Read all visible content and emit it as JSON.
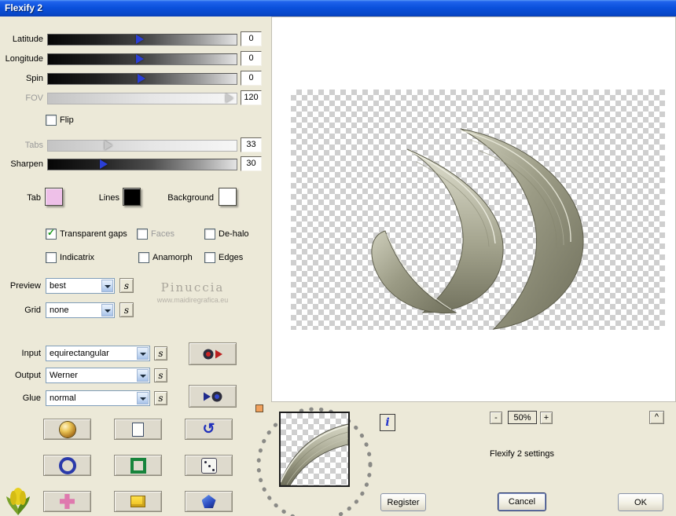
{
  "window": {
    "title": "Flexify 2"
  },
  "left": {
    "sliders": [
      {
        "label": "Latitude",
        "value": "0",
        "disabled": false
      },
      {
        "label": "Longitude",
        "value": "0",
        "disabled": false
      },
      {
        "label": "Spin",
        "value": "0",
        "disabled": false
      },
      {
        "label": "FOV",
        "value": "120",
        "disabled": true
      },
      {
        "label": "Tabs",
        "value": "33",
        "disabled": true
      },
      {
        "label": "Sharpen",
        "value": "30",
        "disabled": false
      }
    ],
    "flip_label": "Flip",
    "swatches": {
      "tab": {
        "label": "Tab",
        "color": "#eec0e8"
      },
      "lines": {
        "label": "Lines",
        "color": "#000000"
      },
      "background": {
        "label": "Background",
        "color": "#ffffff"
      }
    },
    "checkboxes": [
      {
        "label": "Transparent gaps",
        "checked": true,
        "disabled": false
      },
      {
        "label": "Faces",
        "checked": false,
        "disabled": true
      },
      {
        "label": "De-halo",
        "checked": false,
        "disabled": false
      },
      {
        "label": "Indicatrix",
        "checked": false,
        "disabled": false
      },
      {
        "label": "Anamorph",
        "checked": false,
        "disabled": false
      },
      {
        "label": "Edges",
        "checked": false,
        "disabled": false
      }
    ],
    "dropdowns": {
      "preview": {
        "label": "Preview",
        "value": "best"
      },
      "grid": {
        "label": "Grid",
        "value": "none"
      },
      "input": {
        "label": "Input",
        "value": "equirectangular"
      },
      "output": {
        "label": "Output",
        "value": "Werner"
      },
      "glue": {
        "label": "Glue",
        "value": "normal"
      }
    },
    "watermark": {
      "line1": "Pinuccia",
      "line2": "www.maidiregrafica.eu"
    },
    "tool_icons": [
      "shell",
      "copy-page",
      "undo",
      "ring",
      "green-square",
      "dice",
      "flower",
      "pink-cross",
      "yellow-box",
      "blue-pentagon"
    ]
  },
  "icons": {
    "seed": "s",
    "info": "i",
    "undo": "↺",
    "zoom_out": "-",
    "zoom_in": "+",
    "collapse": "^"
  },
  "right": {
    "zoom_level": "50%",
    "settings_text": "Flexify 2 settings",
    "buttons": {
      "register": "Register",
      "cancel": "Cancel",
      "ok": "OK"
    }
  }
}
